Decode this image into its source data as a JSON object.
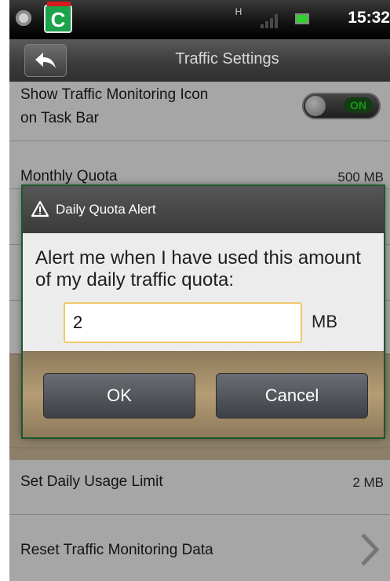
{
  "status_bar": {
    "network": "H",
    "time": "15:32"
  },
  "title_bar": {
    "title": "Traffic Settings"
  },
  "settings": [
    {
      "label_line1": "Show Traffic Monitoring Icon",
      "label_line2": "on Task Bar",
      "toggle": "ON"
    },
    {
      "label": "Monthly Quota",
      "value": "500 MB"
    },
    {
      "label": "Set Daily Usage Limit",
      "value": "2 MB"
    },
    {
      "label": "Reset Traffic Monitoring Data"
    }
  ],
  "dialog": {
    "title": "Daily Quota Alert",
    "message": "Alert me when I have used this amount of my daily traffic quota:",
    "input_value": "2",
    "unit": "MB",
    "ok_label": "OK",
    "cancel_label": "Cancel"
  },
  "colors": {
    "toggle_on": "#2ce02c",
    "input_border": "#f2c86a",
    "dialog_footer": "#b59c74"
  }
}
